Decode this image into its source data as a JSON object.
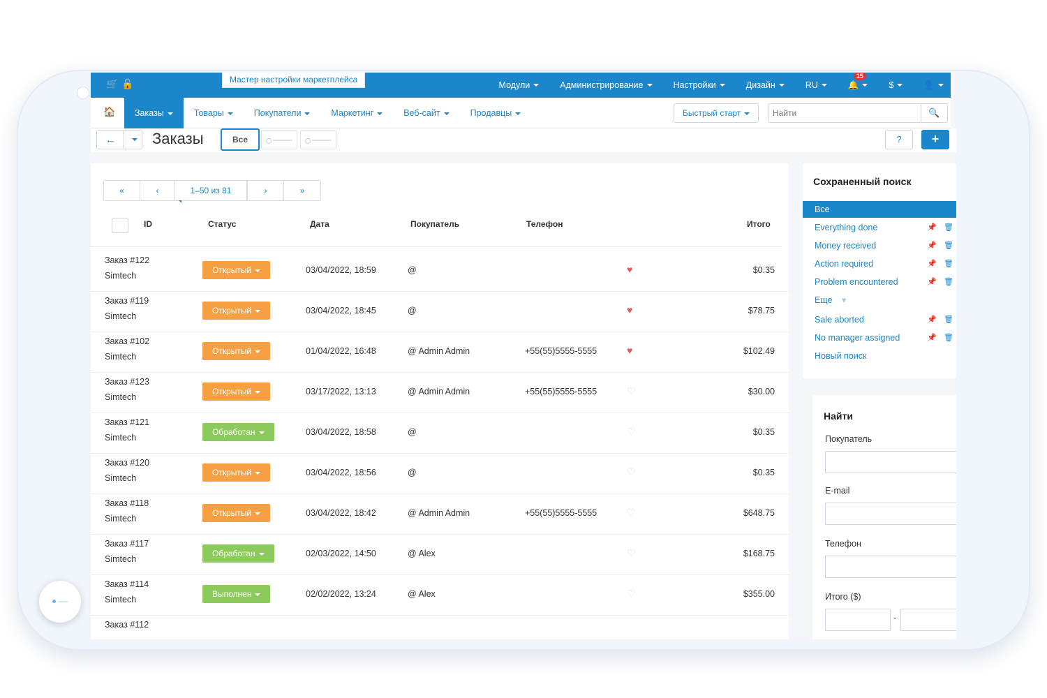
{
  "topbar": {
    "wizard": "Мастер настройки маркетплейса",
    "menu": [
      {
        "label": "Модули"
      },
      {
        "label": "Администрирование"
      },
      {
        "label": "Настройки"
      },
      {
        "label": "Дизайн"
      },
      {
        "label": "RU"
      }
    ],
    "notifications": "15",
    "currency": "$"
  },
  "nav": {
    "items": [
      "Заказы",
      "Товары",
      "Покупатели",
      "Маркетинг",
      "Веб-сайт",
      "Продавцы"
    ],
    "quick_start": "Быстрый старт",
    "search_placeholder": "Найти"
  },
  "toolbar": {
    "title": "Заказы",
    "view_all": "Все"
  },
  "pager": {
    "first": "«",
    "prev": "‹",
    "range": "1–50 из 81",
    "next": "›",
    "last": "»"
  },
  "table": {
    "headers": {
      "id": "ID",
      "status": "Статус",
      "date": "Дата",
      "customer": "Покупатель",
      "phone": "Телефон",
      "total": "Итого"
    },
    "rows": [
      {
        "order": "Заказ #122",
        "company": "Simtech",
        "status": "Открытый",
        "date": "03/04/2022, 18:59",
        "customer": "@",
        "phone": "",
        "fav": true,
        "total": "$0.35"
      },
      {
        "order": "Заказ #119",
        "company": "Simtech",
        "status": "Открытый",
        "date": "03/04/2022, 18:45",
        "customer": "@",
        "phone": "",
        "fav": true,
        "total": "$78.75"
      },
      {
        "order": "Заказ #102",
        "company": "Simtech",
        "status": "Открытый",
        "date": "01/04/2022, 16:48",
        "customer": "@ Admin Admin",
        "phone": "+55(55)5555-5555",
        "fav": true,
        "total": "$102.49"
      },
      {
        "order": "Заказ #123",
        "company": "Simtech",
        "status": "Открытый",
        "date": "03/17/2022, 13:13",
        "customer": "@ Admin Admin",
        "phone": "+55(55)5555-5555",
        "fav": false,
        "total": "$30.00"
      },
      {
        "order": "Заказ #121",
        "company": "Simtech",
        "status": "Обработан",
        "date": "03/04/2022, 18:58",
        "customer": "@",
        "phone": "",
        "fav": false,
        "total": "$0.35"
      },
      {
        "order": "Заказ #120",
        "company": "Simtech",
        "status": "Открытый",
        "date": "03/04/2022, 18:56",
        "customer": "@",
        "phone": "",
        "fav": false,
        "total": "$0.35"
      },
      {
        "order": "Заказ #118",
        "company": "Simtech",
        "status": "Открытый",
        "date": "03/04/2022, 18:42",
        "customer": "@ Admin Admin",
        "phone": "+55(55)5555-5555",
        "fav": false,
        "total": "$648.75"
      },
      {
        "order": "Заказ #117",
        "company": "Simtech",
        "status": "Обработан",
        "date": "02/03/2022, 14:50",
        "customer": "@ Alex",
        "phone": "",
        "fav": false,
        "total": "$168.75"
      },
      {
        "order": "Заказ #114",
        "company": "Simtech",
        "status": "Выполнен",
        "date": "02/02/2022, 13:24",
        "customer": "@ Alex",
        "phone": "",
        "fav": false,
        "total": "$355.00"
      },
      {
        "order": "Заказ #112",
        "company": "",
        "status": "",
        "date": "",
        "customer": "",
        "phone": "",
        "fav": false,
        "total": ""
      }
    ]
  },
  "status_colors": {
    "Открытый": "#f7a043",
    "Обработан": "#8cca5d",
    "Выполнен": "#8cca5d"
  },
  "saved_search": {
    "title": "Сохраненный поиск",
    "items": [
      {
        "label": "Все",
        "active": true,
        "actions": false
      },
      {
        "label": "Everything done",
        "actions": true
      },
      {
        "label": "Money received",
        "actions": true
      },
      {
        "label": "Action required",
        "actions": true
      },
      {
        "label": "Problem encountered",
        "actions": true
      },
      {
        "label": "Еще",
        "more": true
      },
      {
        "label": "Sale aborted",
        "actions": true
      },
      {
        "label": "No manager assigned",
        "actions": true
      },
      {
        "label": "Новый поиск",
        "actions": false
      }
    ]
  },
  "find": {
    "title": "Найти",
    "customer": "Покупатель",
    "email": "E-mail",
    "phone": "Телефон",
    "total": "Итого ($)",
    "range_sep": "-"
  },
  "colors": {
    "primary": "#1b86c9",
    "open": "#f7a043",
    "processed": "#8cca5d",
    "heart": "#e05a5e"
  }
}
